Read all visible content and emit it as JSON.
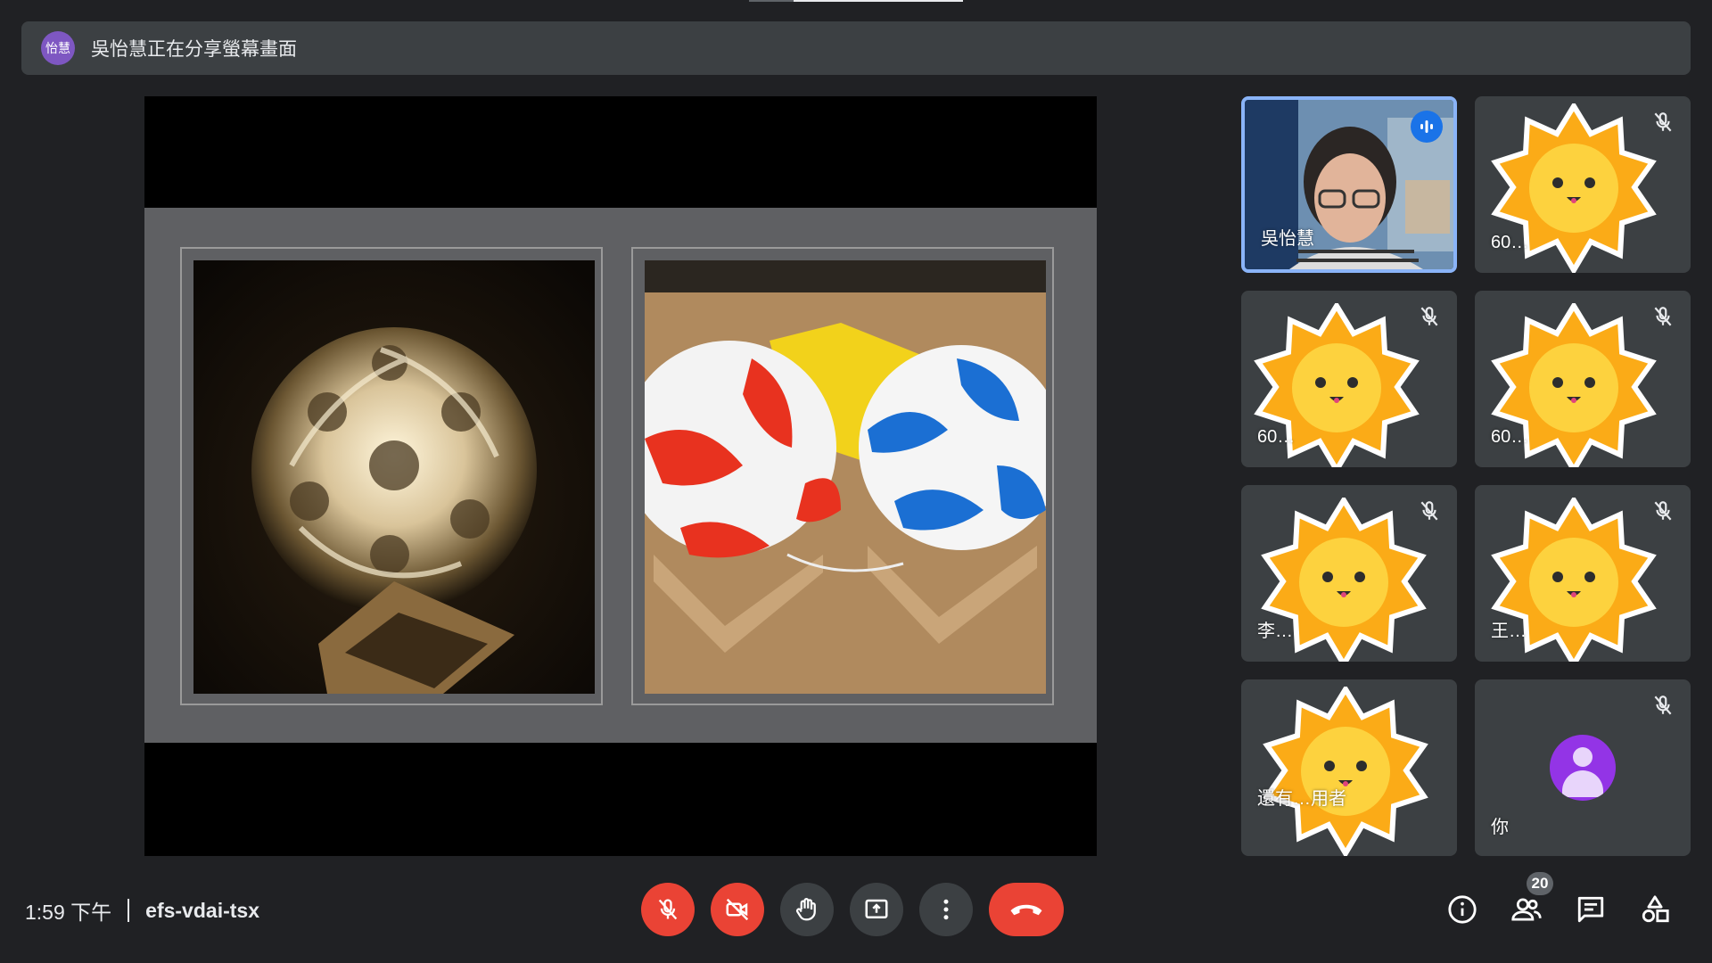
{
  "banner": {
    "avatar_text": "怡慧",
    "message": "吳怡慧正在分享螢幕畫面"
  },
  "participants": [
    {
      "name": "吳怡慧",
      "muted": false,
      "speaking": true,
      "type": "video"
    },
    {
      "name": "60…",
      "muted": true,
      "type": "sun-avatar"
    },
    {
      "name": "60…",
      "muted": true,
      "type": "sun-avatar"
    },
    {
      "name": "60…",
      "muted": true,
      "type": "sun-avatar"
    },
    {
      "name": "李…",
      "muted": true,
      "type": "sun-avatar"
    },
    {
      "name": "王…",
      "muted": true,
      "type": "sun-avatar"
    },
    {
      "name": "還有…用者",
      "muted": false,
      "type": "sun-avatar"
    },
    {
      "name": "你",
      "muted": true,
      "type": "default-avatar"
    }
  ],
  "bottom": {
    "time": "1:59 下午",
    "meeting_code": "efs-vdai-tsx",
    "people_count": "20"
  },
  "controls": {
    "mic": "mic-off-icon",
    "camera": "camera-off-icon",
    "raise_hand": "hand-icon",
    "present": "present-screen-icon",
    "more": "more-vert-icon",
    "leave": "call-end-icon"
  },
  "colors": {
    "background": "#202124",
    "tile": "#3c4043",
    "danger": "#ea4335",
    "speaking_border": "#8ab4f8",
    "accent": "#1a73e8"
  }
}
